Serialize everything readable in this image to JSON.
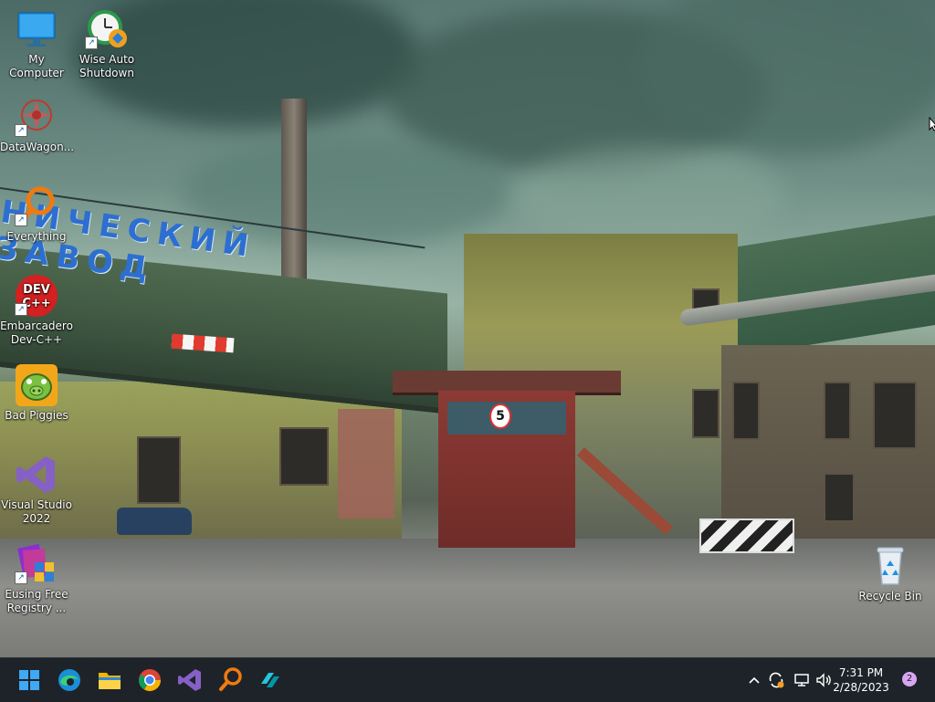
{
  "desktop": {
    "wallpaper_sign": "НИЧЕСКИЙ ЗАВОД",
    "booth_sign_number": "5",
    "icons": [
      {
        "label": "My Computer",
        "icon": "monitor-icon"
      },
      {
        "label": "Wise Auto Shutdown",
        "icon": "clock-shutdown-icon"
      },
      {
        "label": "DataWagon...",
        "icon": "datawagon-icon"
      },
      {
        "label": "Everything",
        "icon": "magnifier-icon"
      },
      {
        "label": "Embarcadero Dev-C++",
        "icon": "devcpp-icon",
        "badge": "DEV C++"
      },
      {
        "label": "Bad Piggies",
        "icon": "green-pig-icon"
      },
      {
        "label": "Visual Studio 2022",
        "icon": "visual-studio-icon"
      },
      {
        "label": "Eusing Free Registry ...",
        "icon": "registry-cleaner-icon"
      },
      {
        "label": "Recycle Bin",
        "icon": "recycle-bin-icon"
      }
    ]
  },
  "taskbar": {
    "pinned": [
      {
        "name": "start-button",
        "icon": "windows-logo-icon"
      },
      {
        "name": "taskbar-edge",
        "icon": "edge-icon"
      },
      {
        "name": "taskbar-file-explorer",
        "icon": "folder-icon"
      },
      {
        "name": "taskbar-chrome",
        "icon": "chrome-icon"
      },
      {
        "name": "taskbar-visual-studio",
        "icon": "visual-studio-icon"
      },
      {
        "name": "taskbar-everything",
        "icon": "magnifier-icon"
      },
      {
        "name": "taskbar-app",
        "icon": "cyan-app-icon"
      }
    ],
    "tray": {
      "icons": [
        "chevron-up-icon",
        "sync-icon",
        "network-icon",
        "speaker-icon"
      ],
      "time": "7:31 PM",
      "date": "2/28/2023",
      "notification_count": "2"
    }
  },
  "colors": {
    "taskbar_bg": "#1e2329",
    "sign_blue": "#2d6fd0",
    "notification_badge": "#d7a6f1"
  }
}
